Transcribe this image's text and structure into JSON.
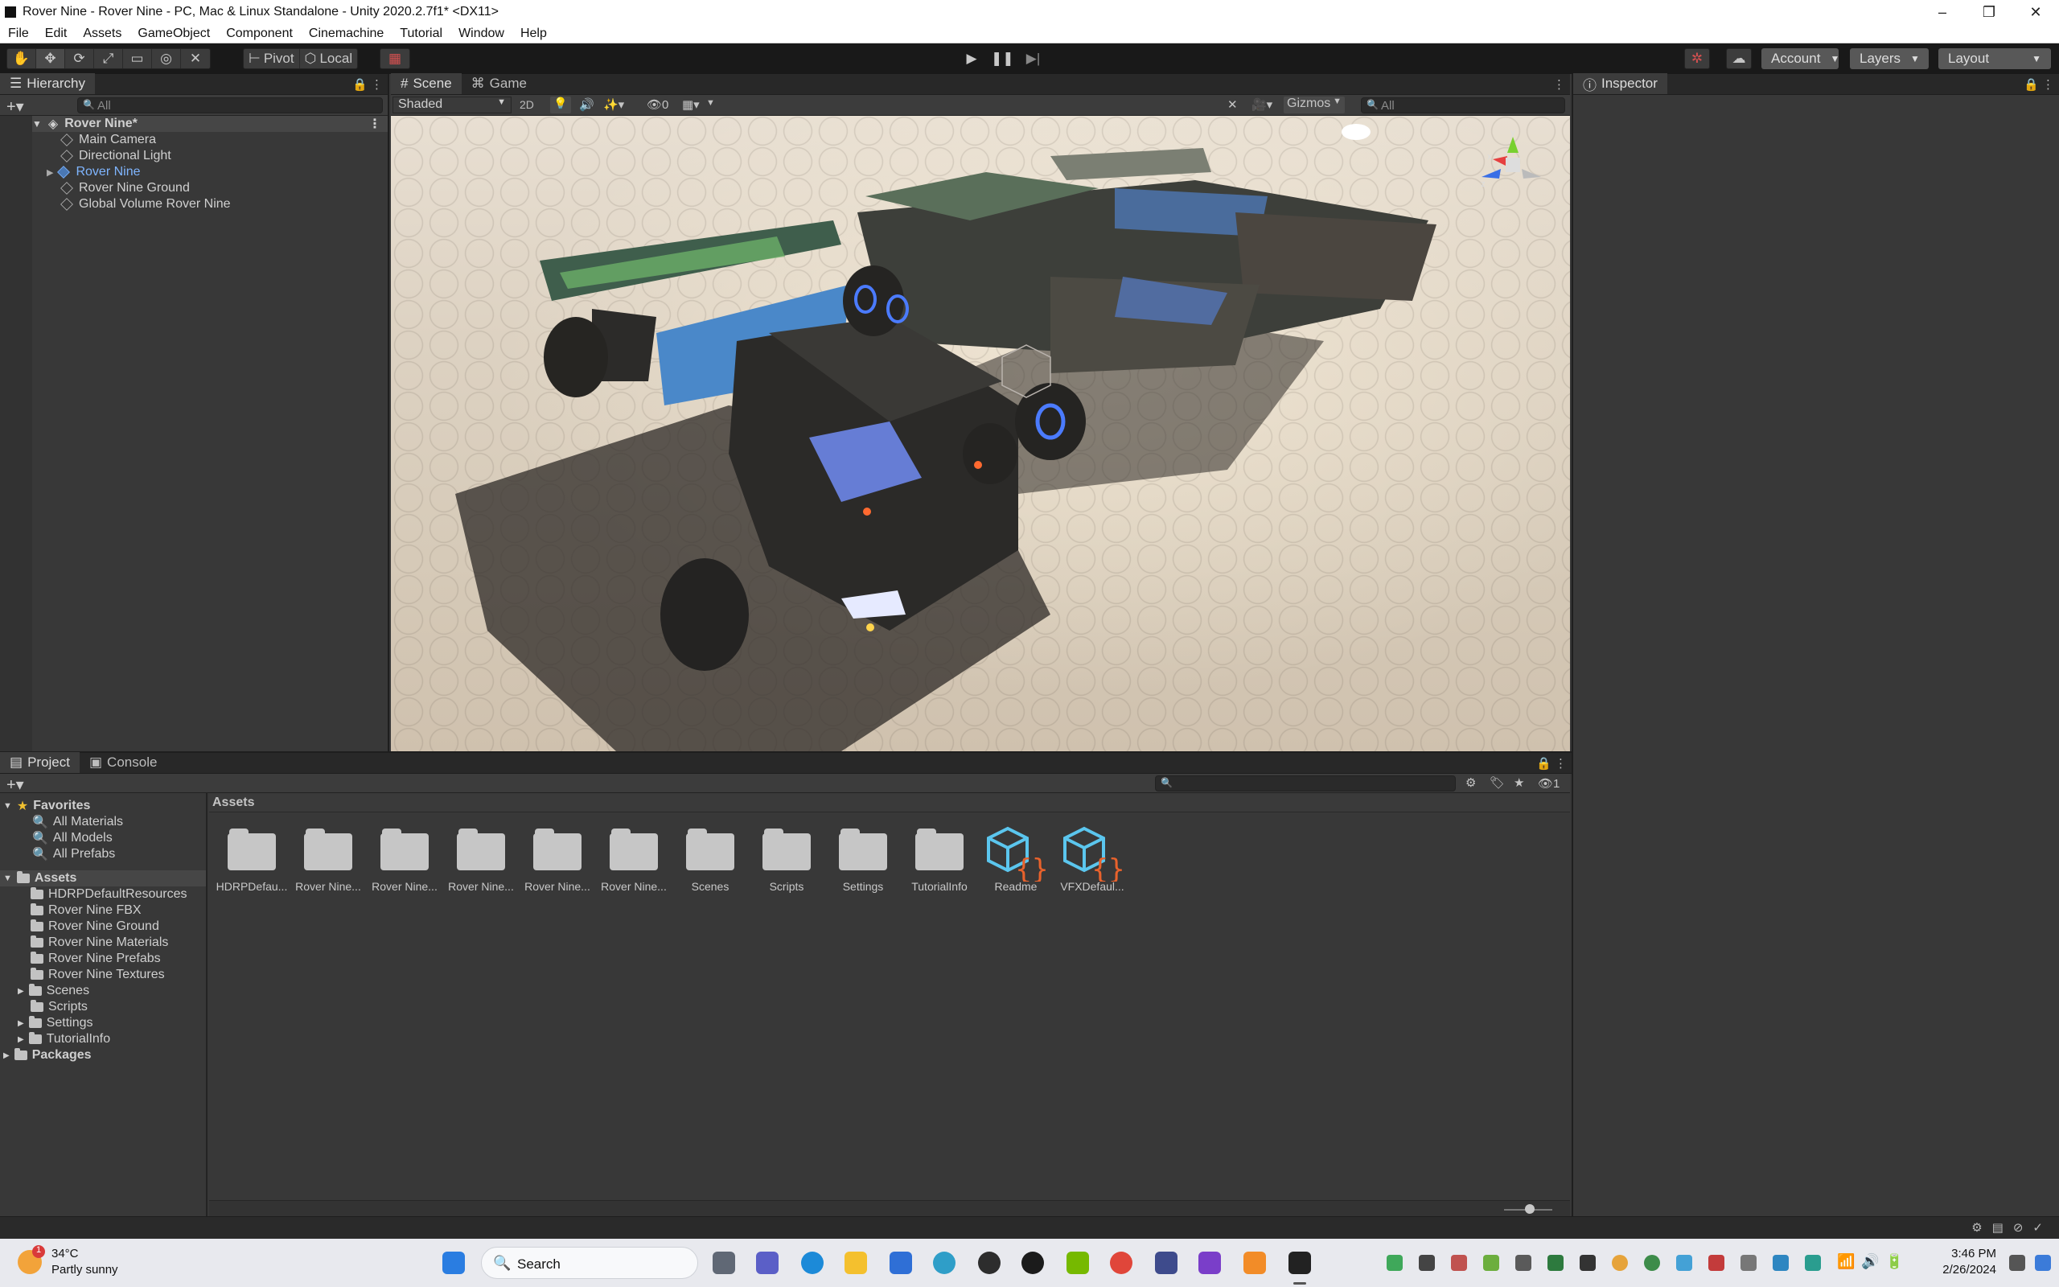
{
  "window": {
    "title": "Rover Nine - Rover Nine - PC, Mac & Linux Standalone - Unity 2020.2.7f1* <DX11>",
    "controls": [
      "–",
      "❐",
      "✕"
    ]
  },
  "menu": [
    "File",
    "Edit",
    "Assets",
    "GameObject",
    "Component",
    "Cinemachine",
    "Tutorial",
    "Window",
    "Help"
  ],
  "toolbar": {
    "pivot_label": "Pivot",
    "local_label": "Local",
    "account_label": "Account",
    "layers_label": "Layers",
    "layout_label": "Layout"
  },
  "hierarchy": {
    "tab": "Hierarchy",
    "search_placeholder": "All",
    "scene_name": "Rover Nine*",
    "items": [
      "Main Camera",
      "Directional Light",
      "Rover Nine",
      "Rover Nine Ground",
      "Global Volume Rover Nine"
    ]
  },
  "scene": {
    "tabs": [
      "Scene",
      "Game"
    ],
    "shading_mode": "Shaded",
    "mode_2d": "2D",
    "hidden_count": "0",
    "gizmos_label": "Gizmos",
    "search_placeholder": "All",
    "gizmo_axes": [
      "y",
      "x",
      "z"
    ]
  },
  "inspector": {
    "tab": "Inspector"
  },
  "project": {
    "tabs": [
      "Project",
      "Console"
    ],
    "breadcrumb": "Assets",
    "hidden_count": "1",
    "favorites_label": "Favorites",
    "favorites": [
      "All Materials",
      "All Models",
      "All Prefabs"
    ],
    "assets_label": "Assets",
    "asset_folders": [
      "HDRPDefaultResources",
      "Rover Nine FBX",
      "Rover Nine Ground",
      "Rover Nine Materials",
      "Rover Nine Prefabs",
      "Rover Nine Textures",
      "Scenes",
      "Scripts",
      "Settings",
      "TutorialInfo"
    ],
    "packages_label": "Packages",
    "grid_items": [
      {
        "label": "HDRPDefau...",
        "type": "folder"
      },
      {
        "label": "Rover Nine...",
        "type": "folder"
      },
      {
        "label": "Rover Nine...",
        "type": "folder"
      },
      {
        "label": "Rover Nine...",
        "type": "folder"
      },
      {
        "label": "Rover Nine...",
        "type": "folder"
      },
      {
        "label": "Rover Nine...",
        "type": "folder"
      },
      {
        "label": "Scenes",
        "type": "folder"
      },
      {
        "label": "Scripts",
        "type": "folder"
      },
      {
        "label": "Settings",
        "type": "folder"
      },
      {
        "label": "TutorialInfo",
        "type": "folder"
      },
      {
        "label": "Readme",
        "type": "asset"
      },
      {
        "label": "VFXDefaul...",
        "type": "asset"
      }
    ]
  },
  "taskbar": {
    "weather_temp": "34°C",
    "weather_desc": "Partly sunny",
    "weather_badge": "1",
    "search_label": "Search",
    "time": "3:46 PM",
    "date": "2/26/2024"
  },
  "colors": {
    "editor_bg": "#383838",
    "toolbar_bg": "#191919",
    "selection_blue": "#7fb5ff",
    "accent_orange": "#e8622c",
    "accent_cyan": "#5bc6ee"
  }
}
